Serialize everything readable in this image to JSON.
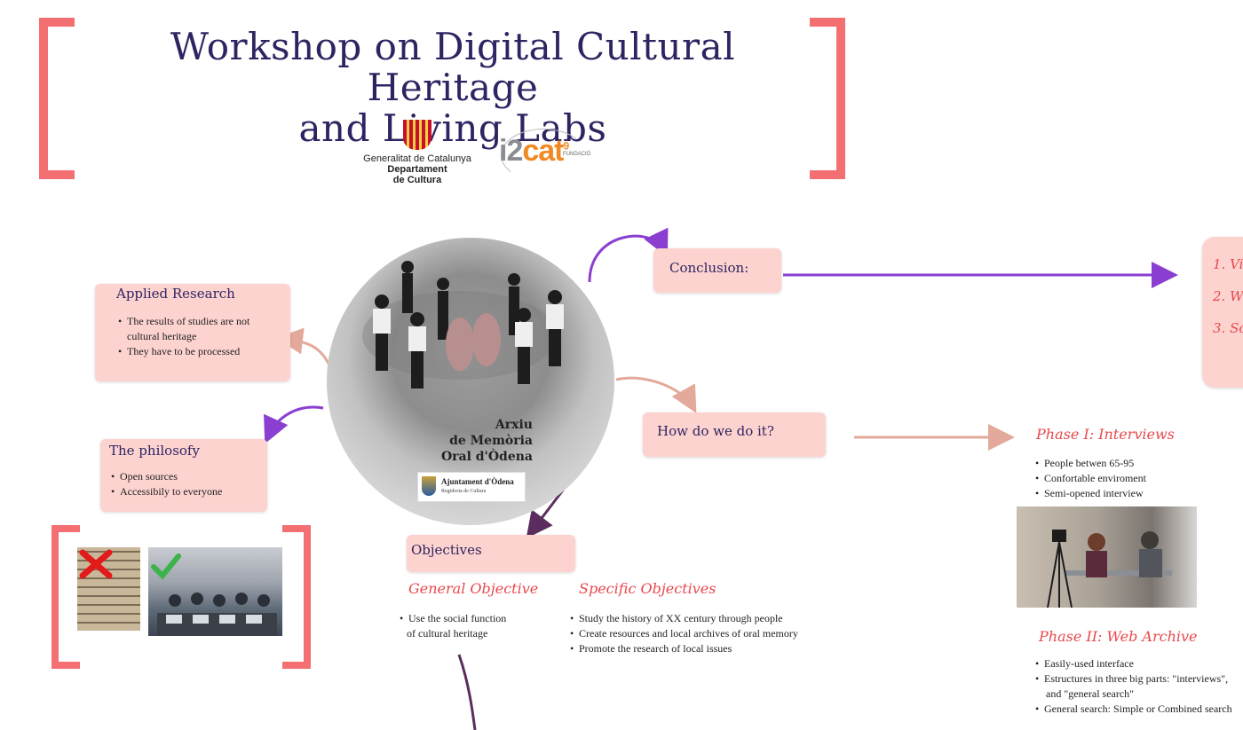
{
  "title": {
    "line1": "Workshop on Digital Cultural Heritage",
    "line2": "and Living Labs"
  },
  "logos": {
    "generalitat": {
      "line1": "Generalitat de Catalunya",
      "line2": "Departament",
      "line3": "de Cultura"
    },
    "i2cat": {
      "prefix": "i2",
      "main": "cat",
      "mark": "9",
      "sub": "FUNDACIÓ"
    }
  },
  "applied_research": {
    "title": "Applied Research",
    "items": [
      "The results of studies are not",
      "cultural heritage",
      "They have to be processed"
    ]
  },
  "philosophy": {
    "title": "The philosofy",
    "items": [
      "Open sources",
      "Accessibily to everyone"
    ]
  },
  "center": {
    "arxiu": [
      "Arxiu",
      "de Memòria",
      "Oral d'Òdena"
    ],
    "ajuntament": "Ajuntament d'Òdena",
    "regidoria": "Regidoria de Cultura"
  },
  "conclusion": {
    "title": "Conclusion:",
    "items": [
      "1. Vi",
      "2. W",
      "3. Sc"
    ]
  },
  "how": {
    "title": "How do we do it?"
  },
  "objectives": {
    "title": "Objectives",
    "general": {
      "title": "General Objective",
      "items": [
        "Use the social function",
        "of cultural heritage"
      ]
    },
    "specific": {
      "title": "Specific Objectives",
      "items": [
        "Study the history of XX century through people",
        "Create resources and local archives of oral memory",
        "Promote the research of local issues"
      ]
    }
  },
  "phase1": {
    "title": "Phase I: Interviews",
    "items": [
      "People betwen 65-95",
      "Confortable enviroment",
      "Semi-opened interview"
    ]
  },
  "phase2": {
    "title": "Phase II: Web Archive",
    "items": [
      "Easily-used interface",
      "Estructures in three big parts: \"interviews\",",
      "and \"general search\"",
      "General search: Simple or Combined search"
    ]
  },
  "colors": {
    "title": "#2e2462",
    "bracket": "#f2575a",
    "card": "#fdd3cf",
    "phase": "#e8484c",
    "arrow_purple": "#8a3fd1",
    "arrow_peach": "#e3a99a"
  }
}
